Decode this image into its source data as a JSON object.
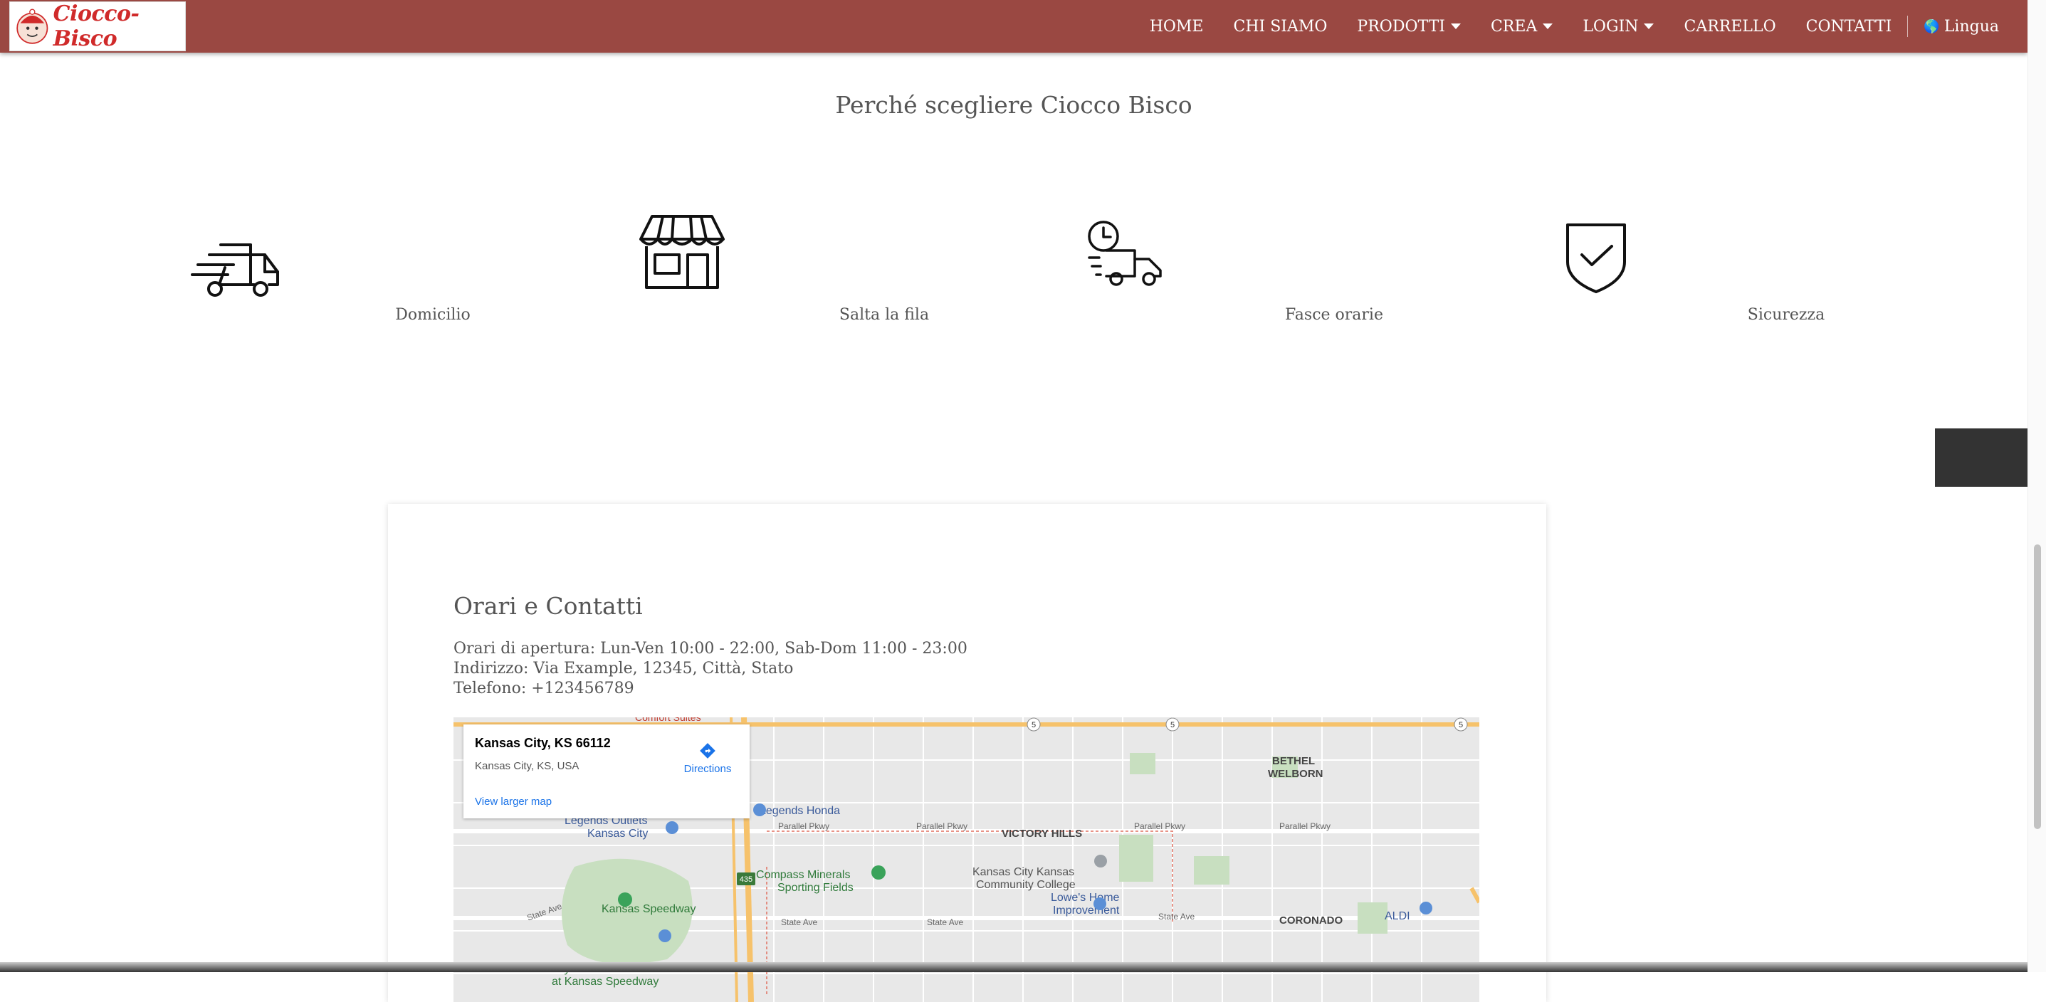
{
  "nav": {
    "brand": "Ciocco-Bisco",
    "items": [
      {
        "label": "HOME",
        "dropdown": false
      },
      {
        "label": "CHI SIAMO",
        "dropdown": false
      },
      {
        "label": "PRODOTTI",
        "dropdown": true
      },
      {
        "label": "CREA",
        "dropdown": true
      },
      {
        "label": "LOGIN",
        "dropdown": true
      },
      {
        "label": "CARRELLO",
        "dropdown": false
      },
      {
        "label": "CONTATTI",
        "dropdown": false
      }
    ],
    "language": "Lingua"
  },
  "why": {
    "title": "Perché scegliere Ciocco Bisco",
    "features": [
      {
        "label": "Domicilio",
        "icon": "delivery-truck-icon"
      },
      {
        "label": "Salta la fila",
        "icon": "storefront-icon"
      },
      {
        "label": "Fasce orarie",
        "icon": "clock-truck-icon"
      },
      {
        "label": "Sicurezza",
        "icon": "shield-check-icon"
      }
    ]
  },
  "contacts": {
    "title": "Orari e Contatti",
    "hours": "Orari di apertura: Lun-Ven 10:00 - 22:00, Sab-Dom 11:00 - 23:00",
    "address": "Indirizzo: Via Example, 12345, Città, Stato",
    "phone": "Telefono: +123456789"
  },
  "map": {
    "place_title": "Kansas City, KS 66112",
    "place_subtitle": "Kansas City, KS, USA",
    "directions": "Directions",
    "larger_map": "View larger map",
    "labels": {
      "legends_honda": "Legends Honda",
      "legends_outlets": "Legends Outlets\nKansas City",
      "victory_hills": "VICTORY HILLS",
      "kcc_college": "Kansas City Kansas\nCommunity College",
      "compass": "Compass Minerals\nSporting Fields",
      "lowes": "Lowe's Home\nImprovement",
      "kansas_speedway": "Kansas Speedway",
      "hollywood_casino": "Hollywood Casino\nat Kansas Speedway",
      "coronado": "CORONADO",
      "aldi": "ALDI",
      "bethel_welborn": "BETHEL\nWELBORN",
      "parallel_pkwy": "Parallel Pkwy",
      "state_ave": "State Ave",
      "comfort_suites": "Comfort Suites"
    }
  }
}
